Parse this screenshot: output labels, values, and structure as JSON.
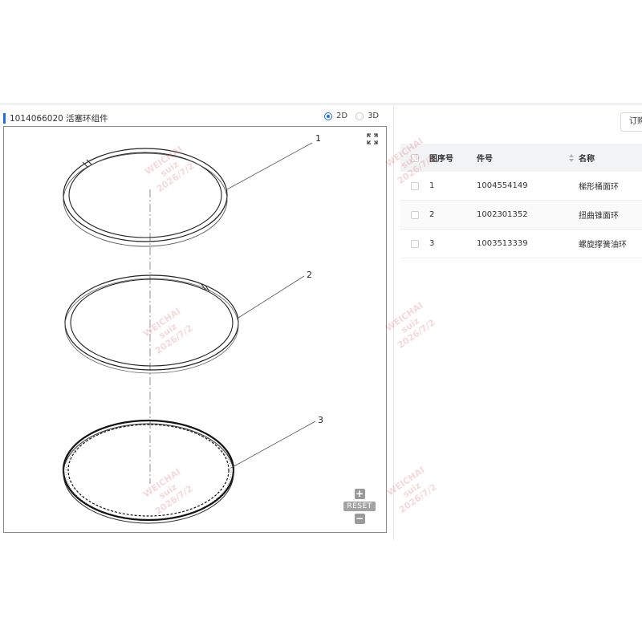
{
  "header": {
    "title": "1014066020 活塞环组件"
  },
  "view_toggle": {
    "options": [
      {
        "label": "2D",
        "selected": true
      },
      {
        "label": "3D",
        "selected": false
      }
    ]
  },
  "viewer": {
    "callouts": [
      "1",
      "2",
      "3"
    ],
    "controls": {
      "zoom_in": "+",
      "reset_label": "RESET",
      "zoom_out": "−"
    }
  },
  "toolbar": {
    "order_label": "订购"
  },
  "table": {
    "columns": {
      "index": "图序号",
      "part_no": "件号",
      "name": "名称"
    },
    "rows": [
      {
        "index": "1",
        "part_no": "1004554149",
        "name": "梯形桶面环"
      },
      {
        "index": "2",
        "part_no": "1002301352",
        "name": "扭曲锥面环"
      },
      {
        "index": "3",
        "part_no": "1003513339",
        "name": "螺旋撑簧油环"
      }
    ]
  },
  "watermark": {
    "brand": "WEICHAI",
    "user": "suiz",
    "date": "2026/7/2"
  },
  "colors": {
    "accent": "#1f6fe5",
    "header_bg": "#f2f3f5",
    "watermark": "#d25050"
  }
}
